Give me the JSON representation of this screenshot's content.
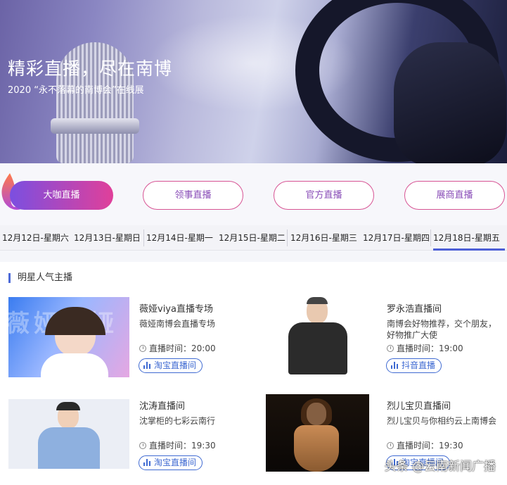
{
  "banner": {
    "title": "精彩直播，尽在南博",
    "subtitle": "2020 “永不落幕的南博会”在线展"
  },
  "categories": [
    {
      "label": "大咖直播",
      "active": true
    },
    {
      "label": "领事直播",
      "active": false
    },
    {
      "label": "官方直播",
      "active": false
    },
    {
      "label": "展商直播",
      "active": false
    }
  ],
  "dates": [
    {
      "label": "12月12日-星期六",
      "selected": false
    },
    {
      "label": "12月13日-星期日",
      "selected": false
    },
    {
      "label": "12月14日-星期一",
      "selected": false
    },
    {
      "label": "12月15日-星期二",
      "selected": false
    },
    {
      "label": "12月16日-星期三",
      "selected": false
    },
    {
      "label": "12月17日-星期四",
      "selected": false
    },
    {
      "label": "12月18日-星期五",
      "selected": true
    }
  ],
  "section": {
    "title": "明星人气主播"
  },
  "streamers": [
    {
      "name": "薇娅viya直播专场",
      "desc": "薇娅南博会直播专场",
      "time": "直播时间：20:00",
      "platform": "淘宝直播间",
      "thumb_text": "薇娅薇娅"
    },
    {
      "name": "罗永浩直播间",
      "desc": "南博会好物推荐，交个朋友，好物推广大使",
      "time": "直播时间：19:00",
      "platform": "抖音直播"
    },
    {
      "name": "沈涛直播间",
      "desc": "沈掌柜的七彩云南行",
      "time": "直播时间：19:30",
      "platform": "淘宝直播间"
    },
    {
      "name": "烈儿宝贝直播间",
      "desc": "烈儿宝贝与你相约云上南博会",
      "time": "直播时间：19:30",
      "platform": "淘宝直播间"
    }
  ],
  "watermark": "头条 @云南新闻广播",
  "colors": {
    "accent": "#4d5fd6",
    "gradient_start": "#7b4fe0",
    "gradient_end": "#e0409a",
    "pill_border": "#d75494",
    "platform_blue": "#3f6ad2"
  }
}
